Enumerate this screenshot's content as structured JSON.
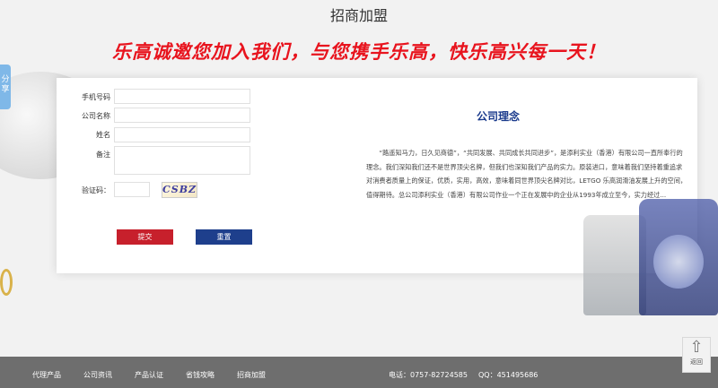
{
  "page": {
    "title": "招商加盟",
    "slogan": "乐高诚邀您加入我们，与您携手乐高，快乐高兴每一天！"
  },
  "share": {
    "label": "分享"
  },
  "form": {
    "phone_label": "手机号码",
    "company_label": "公司名称",
    "name_label": "姓名",
    "note_label": "备注",
    "captcha_label": "验证码：",
    "captcha_text": "CSBZ",
    "submit_label": "提交",
    "reset_label": "重置"
  },
  "philosophy": {
    "title": "公司理念",
    "text": "“路遥知马力，日久见商德”，“共同发展、共同成长共同进步”，是添利实业（香港）有限公司一直所奉行的理念。我们深知我们还不是世界顶尖名牌，但我们也深知我们产品的实力。原装进口，意味着我们坚持着重追求对消费者质量上的保证，优质，实用，高效，意味着同世界顶尖名牌对比，LETGO 乐高润滑油发展上升的空间，值得期待。总公司添利实业（香港）有限公司作业一个正在发展中的企业从1993年成立至今，实力经过..."
  },
  "footer": {
    "links": [
      "代理产品",
      "公司资讯",
      "产品认证",
      "省钱攻略",
      "招商加盟"
    ],
    "phone": "电话：0757-82724585",
    "qq": "QQ：451495686"
  },
  "back_top": {
    "label": "返回"
  },
  "colors": {
    "slogan": "#e8141e",
    "submit": "#c7202c",
    "reset": "#1e3f8c",
    "title_blue": "#1a3a8c",
    "footer_bg": "#6e6e6e"
  }
}
